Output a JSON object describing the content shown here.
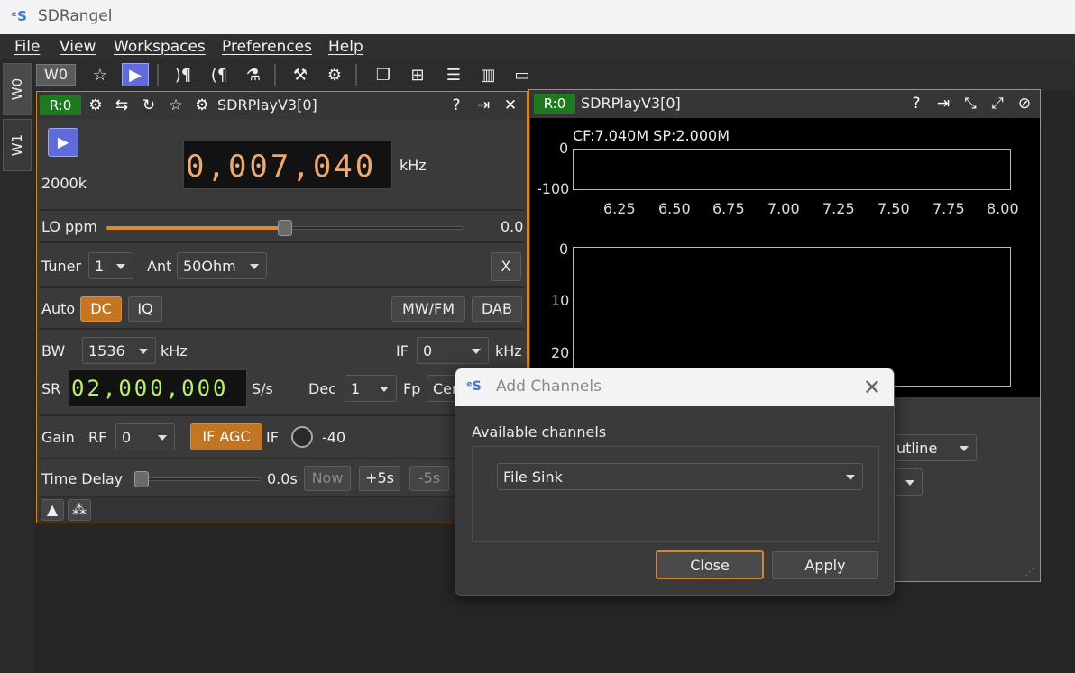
{
  "app": {
    "title": "SDRangel"
  },
  "menu": [
    "File",
    "View",
    "Workspaces",
    "Preferences",
    "Help"
  ],
  "workspace_tabs": [
    "W0",
    "W1"
  ],
  "toolbar": {
    "workspace_label": "W0"
  },
  "device_panel": {
    "rx_tag": "R:0",
    "title": "SDRPlayV3[0]",
    "sample_rate_label": "2000k",
    "center_freq": "0,007,040",
    "center_freq_unit": "kHz",
    "lo_ppm_label": "LO ppm",
    "lo_ppm_value": "0.0",
    "lo_ppm_position": 0.5,
    "tuner_label": "Tuner",
    "tuner_value": "1",
    "ant_label": "Ant",
    "ant_value": "50Ohm",
    "x_button": "X",
    "auto_label": "Auto",
    "dc_button": "DC",
    "iq_button": "IQ",
    "mwfm_button": "MW/FM",
    "dab_button": "DAB",
    "bw_label": "BW",
    "bw_value": "1536",
    "bw_unit": "kHz",
    "if_label": "IF",
    "if_value": "0",
    "if_unit": "kHz",
    "sr_label": "SR",
    "sr_value": "02,000,000",
    "sr_unit": "S/s",
    "dec_label": "Dec",
    "dec_value": "1",
    "fp_label": "Fp",
    "fp_value": "Cen",
    "gain_label": "Gain",
    "rf_label": "RF",
    "rf_value": "0",
    "ifagc_button": "IF AGC",
    "if_gain_label": "IF",
    "if_gain_value": "-40",
    "time_delay_label": "Time Delay",
    "time_delay_value": "0.0s",
    "now_button": "Now",
    "plus5_button": "+5s",
    "minus5_button": "-5s"
  },
  "spectrum_panel": {
    "rx_tag": "R:0",
    "title": "SDRPlayV3[0]",
    "info": "CF:7.040M SP:2.000M",
    "y_ticks_top": [
      "0",
      "-100"
    ],
    "x_ticks": [
      "6.25",
      "6.50",
      "6.75",
      "7.00",
      "7.25",
      "7.50",
      "7.75",
      "8.00"
    ],
    "y_ticks_bottom": [
      "0",
      "10",
      "20"
    ],
    "combo_outline": "utline"
  },
  "dialog": {
    "title": "Add Channels",
    "group_label": "Available channels",
    "selected_channel": "File Sink",
    "close_button": "Close",
    "apply_button": "Apply"
  },
  "colors": {
    "accent": "#d6862a",
    "rx_tag": "#1f7a1f",
    "play": "#5e6bd8",
    "freq_digits": "#f0a870",
    "sr_digits": "#b8f070"
  }
}
